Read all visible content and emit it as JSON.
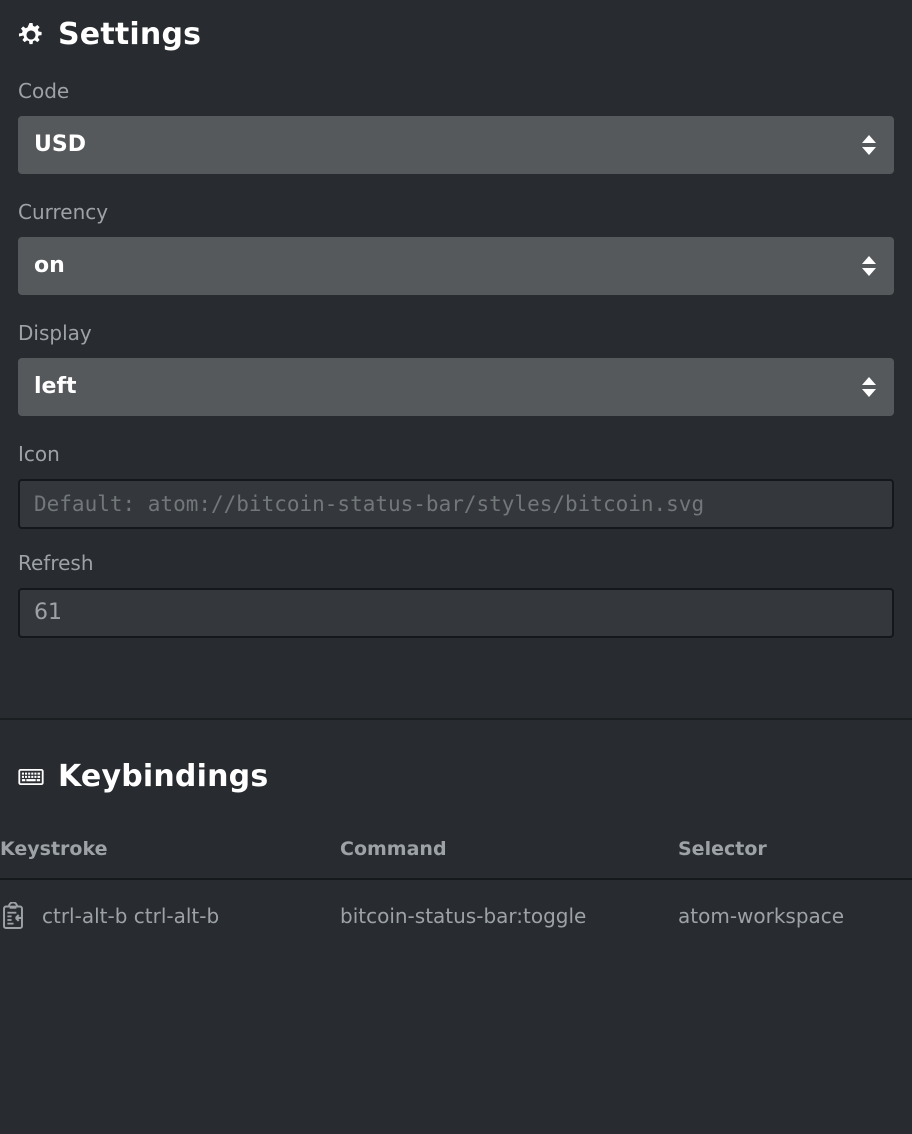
{
  "theme": {
    "page_background": "#282c30",
    "select_background": "#55595c",
    "input_background": "#34383c",
    "input_border": "#15181a",
    "label_color": "#9da2a6",
    "value_color": "#ffffff",
    "divider_color": "#1b1e20"
  },
  "settings": {
    "heading": "Settings",
    "heading_icon": "gear-icon",
    "fields": [
      {
        "label": "Code",
        "type": "select",
        "value": "USD"
      },
      {
        "label": "Currency",
        "type": "select",
        "value": "on"
      },
      {
        "label": "Display",
        "type": "select",
        "value": "left"
      },
      {
        "label": "Icon",
        "type": "text",
        "value": "",
        "placeholder": "Default: atom://bitcoin-status-bar/styles/bitcoin.svg"
      },
      {
        "label": "Refresh",
        "type": "text",
        "value": "61",
        "placeholder": ""
      }
    ]
  },
  "keybindings": {
    "heading": "Keybindings",
    "heading_icon": "keyboard-icon",
    "columns": {
      "keystroke": "Keystroke",
      "command": "Command",
      "selector": "Selector"
    },
    "rows": [
      {
        "copy_icon": "clipboard-copy-icon",
        "keystroke": "ctrl-alt-b ctrl-alt-b",
        "command": "bitcoin-status-bar:toggle",
        "selector": "atom-workspace"
      }
    ]
  }
}
